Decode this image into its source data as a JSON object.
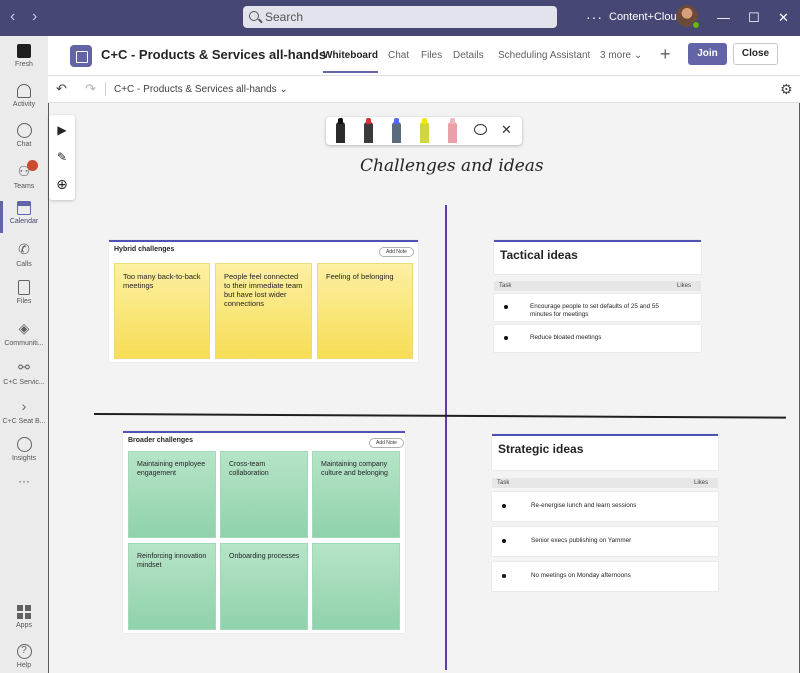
{
  "app": {
    "search_placeholder": "Search",
    "org_name": "Content+Cloud",
    "nav_back": "‹",
    "nav_forward": "›",
    "more_options": "···",
    "window_min": "—",
    "window_max": "☐",
    "window_close": "✕"
  },
  "rail": {
    "items": [
      {
        "label": "Fresh"
      },
      {
        "label": "Activity"
      },
      {
        "label": "Chat"
      },
      {
        "label": "Teams"
      },
      {
        "label": "Calendar"
      },
      {
        "label": "Calls"
      },
      {
        "label": "Files"
      },
      {
        "label": "Communiti..."
      },
      {
        "label": "C+C Servic..."
      },
      {
        "label": "C+C Seat B..."
      },
      {
        "label": "Insights"
      },
      {
        "label": "···"
      },
      {
        "label": "Apps"
      },
      {
        "label": "Help"
      }
    ],
    "active": "Calendar"
  },
  "meeting": {
    "title": "C+C - Products & Services all-hands",
    "tabs": [
      "Whiteboard",
      "Chat",
      "Files",
      "Details",
      "Scheduling Assistant",
      "3 more"
    ],
    "active_tab": "Whiteboard",
    "plus": "+",
    "join_label": "Join",
    "close_label": "Close"
  },
  "whiteboard": {
    "title": "C+C - Products & Services all-hands",
    "undo": "↶",
    "redo": "↷",
    "gear": "⚙",
    "board_title": "Challenges and ideas",
    "tools": {
      "select": "▶",
      "pen": "✎",
      "add": "⊕",
      "close": "✕"
    },
    "hybrid": {
      "title": "Hybrid challenges",
      "add_note": "Add Note",
      "notes": [
        "Too many back-to-back meetings",
        "People feel connected to their immediate team but have lost wider connections",
        "Feeling of belonging"
      ]
    },
    "broader": {
      "title": "Broader challenges",
      "add_note": "Add Note",
      "notes": [
        "Maintaining employee engagement",
        "Cross-team collaboration",
        "Maintaining company culture and belonging",
        "Reinforcing innovation mindset",
        "Onboarding processes",
        ""
      ]
    },
    "tactical": {
      "title": "Tactical ideas",
      "col_task": "Task",
      "col_likes": "Likes",
      "items": [
        "Encourage people to set defaults of 25 and 55 minutes for meetings",
        "Reduce bloated meetings"
      ]
    },
    "strategic": {
      "title": "Strategic ideas",
      "col_task": "Task",
      "col_likes": "Likes",
      "items": [
        "Re-energise lunch and learn sessions",
        "Senior execs publishing on Yammer",
        "No meetings on Monday afternoons"
      ]
    }
  },
  "colors": {
    "titlebar": "#464775",
    "accent": "#6264a7",
    "divider_vertical": "#5c3ea0",
    "sticky_yellow": "#f7dd55",
    "sticky_green": "#8fd2ab"
  }
}
